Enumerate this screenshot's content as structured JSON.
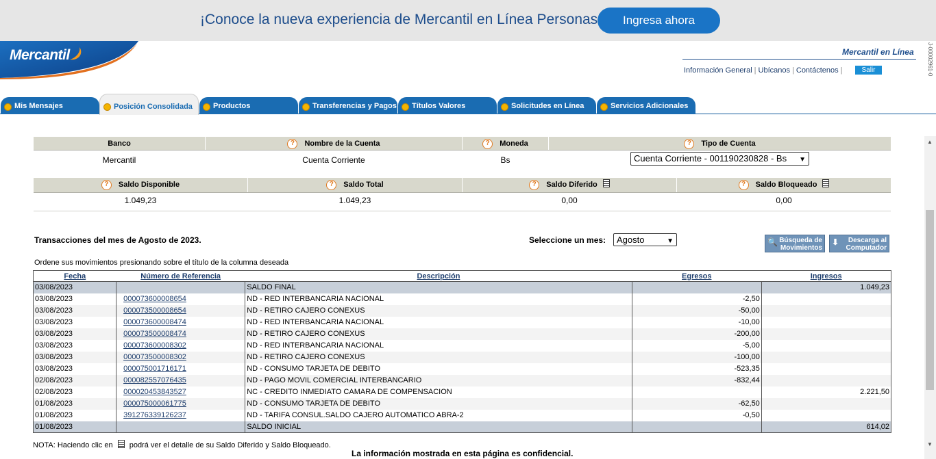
{
  "banner": {
    "text": "¡Conoce la nueva experiencia de Mercantil en Línea Personas!",
    "button": "Ingresa ahora"
  },
  "brand": {
    "logo": "Mercantil",
    "site_title": "Mercantil en Línea",
    "vertical_code": "J-00002961-0"
  },
  "toplinks": {
    "info": "Información General",
    "ubicanos": "Ubícanos",
    "contactenos": "Contáctenos",
    "salir": "Salir"
  },
  "tabs": [
    {
      "label": "Mis Mensajes"
    },
    {
      "label": "Posición Consolidada"
    },
    {
      "label": "Productos"
    },
    {
      "label": "Transferencias y Pagos"
    },
    {
      "label": "Títulos Valores"
    },
    {
      "label": "Solicitudes en Línea"
    },
    {
      "label": "Servicios Adicionales"
    }
  ],
  "account": {
    "headers": {
      "banco": "Banco",
      "nombre": "Nombre de la Cuenta",
      "moneda": "Moneda",
      "tipo": "Tipo de Cuenta"
    },
    "banco": "Mercantil",
    "nombre": "Cuenta Corriente",
    "moneda": "Bs",
    "tipo_selected": "Cuenta Corriente - 001190230828 - Bs"
  },
  "balances": {
    "headers": {
      "disponible": "Saldo Disponible",
      "total": "Saldo Total",
      "diferido": "Saldo Diferido",
      "bloqueado": "Saldo Bloqueado"
    },
    "disponible": "1.049,23",
    "total": "1.049,23",
    "diferido": "0,00",
    "bloqueado": "0,00"
  },
  "transactions": {
    "title": "Transacciones del mes de Agosto de 2023.",
    "month_label": "Seleccione un mes:",
    "month_selected": "Agosto",
    "search_button": "Búsqueda de Movimientos",
    "download_button": "Descarga al Computador",
    "order_note": "Ordene sus movimientos presionando sobre el título de la columna deseada",
    "columns": {
      "fecha": "Fecha",
      "referencia": "Número de Referencia",
      "descripcion": "Descripción",
      "egresos": "Egresos",
      "ingresos": "Ingresos"
    },
    "rows": [
      {
        "fecha": "03/08/2023",
        "ref": "",
        "desc": "SALDO FINAL",
        "egresos": "",
        "ingresos": "1.049,23",
        "style": "grey"
      },
      {
        "fecha": "03/08/2023",
        "ref": "000073600008654",
        "desc": "ND - RED INTERBANCARIA NACIONAL",
        "egresos": "-2,50",
        "ingresos": "",
        "style": "light"
      },
      {
        "fecha": "03/08/2023",
        "ref": "000073500008654",
        "desc": "ND - RETIRO CAJERO CONEXUS",
        "egresos": "-50,00",
        "ingresos": "",
        "style": "alt"
      },
      {
        "fecha": "03/08/2023",
        "ref": "000073600008474",
        "desc": "ND - RED INTERBANCARIA NACIONAL",
        "egresos": "-10,00",
        "ingresos": "",
        "style": "light"
      },
      {
        "fecha": "03/08/2023",
        "ref": "000073500008474",
        "desc": "ND - RETIRO CAJERO CONEXUS",
        "egresos": "-200,00",
        "ingresos": "",
        "style": "alt"
      },
      {
        "fecha": "03/08/2023",
        "ref": "000073600008302",
        "desc": "ND - RED INTERBANCARIA NACIONAL",
        "egresos": "-5,00",
        "ingresos": "",
        "style": "light"
      },
      {
        "fecha": "03/08/2023",
        "ref": "000073500008302",
        "desc": "ND - RETIRO CAJERO CONEXUS",
        "egresos": "-100,00",
        "ingresos": "",
        "style": "alt"
      },
      {
        "fecha": "03/08/2023",
        "ref": "000075001716171",
        "desc": "ND - CONSUMO TARJETA DE DEBITO",
        "egresos": "-523,35",
        "ingresos": "",
        "style": "light"
      },
      {
        "fecha": "02/08/2023",
        "ref": "000082557076435",
        "desc": "ND - PAGO MOVIL COMERCIAL INTERBANCARIO",
        "egresos": "-832,44",
        "ingresos": "",
        "style": "alt"
      },
      {
        "fecha": "02/08/2023",
        "ref": "000020453843527",
        "desc": "NC - CREDITO INMEDIATO CAMARA DE COMPENSACION",
        "egresos": "",
        "ingresos": "2.221,50",
        "style": "light"
      },
      {
        "fecha": "01/08/2023",
        "ref": "000075000061775",
        "desc": "ND - CONSUMO TARJETA DE DEBITO",
        "egresos": "-62,50",
        "ingresos": "",
        "style": "alt"
      },
      {
        "fecha": "01/08/2023",
        "ref": "391276339126237",
        "desc": "ND - TARIFA CONSUL.SALDO CAJERO AUTOMATICO ABRA-2",
        "egresos": "-0,50",
        "ingresos": "",
        "style": "light"
      },
      {
        "fecha": "01/08/2023",
        "ref": "",
        "desc": "SALDO INICIAL",
        "egresos": "",
        "ingresos": "614,02",
        "style": "grey"
      }
    ]
  },
  "footer": {
    "nota_prefix": "NOTA: Haciendo clic en",
    "nota_suffix": "podrá ver el detalle de su Saldo Diferido y Saldo Bloqueado.",
    "confidential": "La información mostrada en esta página es confidencial."
  },
  "colors": {
    "brand_blue": "#1a6cb2",
    "banner_bg": "#e6e6e6",
    "link": "#1d3d6c",
    "warn_orange": "#e07a1f"
  }
}
